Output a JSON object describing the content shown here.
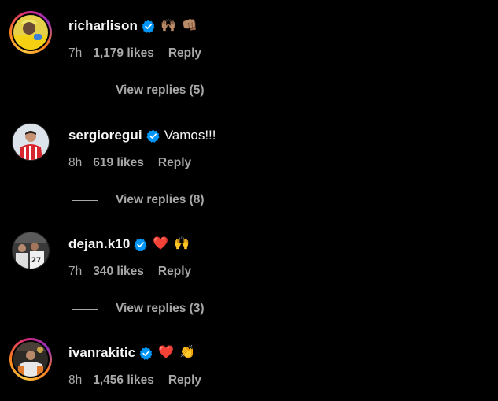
{
  "colors": {
    "background": "#000000",
    "primary_text": "#f5f5f5",
    "secondary_text": "#a8a8a8",
    "verified_badge": "#0095f6",
    "heart": "#ff3040"
  },
  "comments": [
    {
      "username": "richarlison",
      "verified": true,
      "text": "",
      "emojis": [
        "🙌🏽",
        "👊🏽"
      ],
      "time": "7h",
      "likes": "1,179 likes",
      "reply_label": "Reply",
      "view_replies": "View replies (5)",
      "avatar_icon": "richarlison-avatar",
      "has_story_ring": true
    },
    {
      "username": "sergioregui",
      "verified": true,
      "text": "Vamos!!!",
      "emojis": [],
      "time": "8h",
      "likes": "619 likes",
      "reply_label": "Reply",
      "view_replies": "View replies (8)",
      "avatar_icon": "sergioregui-avatar",
      "has_story_ring": false
    },
    {
      "username": "dejan.k10",
      "verified": true,
      "text": "",
      "emojis": [
        "❤️",
        "🙌"
      ],
      "time": "7h",
      "likes": "340 likes",
      "reply_label": "Reply",
      "view_replies": "View replies (3)",
      "avatar_icon": "dejan-k10-avatar",
      "has_story_ring": false
    },
    {
      "username": "ivanrakitic",
      "verified": true,
      "text": "",
      "emojis": [
        "❤️",
        "👏"
      ],
      "time": "8h",
      "likes": "1,456 likes",
      "reply_label": "Reply",
      "view_replies": "",
      "avatar_icon": "ivanrakitic-avatar",
      "has_story_ring": true
    }
  ]
}
